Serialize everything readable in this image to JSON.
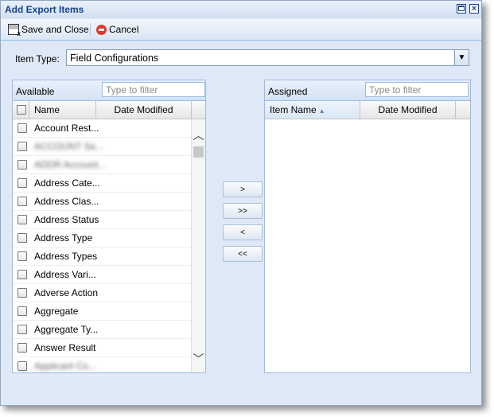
{
  "window": {
    "title": "Add Export Items"
  },
  "toolbar": {
    "save_label": "Save and Close",
    "cancel_label": "Cancel"
  },
  "item_type": {
    "label": "Item Type:",
    "value": "Field Configurations"
  },
  "available": {
    "title": "Available",
    "filter_placeholder": "Type to filter",
    "columns": {
      "name": "Name",
      "date": "Date Modified"
    },
    "items": [
      {
        "label": "Account Rest...",
        "obscured": false
      },
      {
        "label": "ACCOUNT Se...",
        "obscured": true
      },
      {
        "label": "ADDR Account...",
        "obscured": true
      },
      {
        "label": "Address Cate...",
        "obscured": false
      },
      {
        "label": "Address Clas...",
        "obscured": false
      },
      {
        "label": "Address Status",
        "obscured": false
      },
      {
        "label": "Address Type",
        "obscured": false
      },
      {
        "label": "Address Types",
        "obscured": false
      },
      {
        "label": "Address Vari...",
        "obscured": false
      },
      {
        "label": "Adverse Action",
        "obscured": false
      },
      {
        "label": "Aggregate",
        "obscured": false
      },
      {
        "label": "Aggregate Ty...",
        "obscured": false
      },
      {
        "label": "Answer Result",
        "obscured": false
      },
      {
        "label": "Applicant Co...",
        "obscured": true
      }
    ]
  },
  "assigned": {
    "title": "Assigned",
    "filter_placeholder": "Type to filter",
    "columns": {
      "name": "Item Name",
      "date": "Date Modified"
    }
  },
  "move_buttons": {
    "add": ">",
    "add_all": ">>",
    "remove": "<",
    "remove_all": "<<"
  }
}
